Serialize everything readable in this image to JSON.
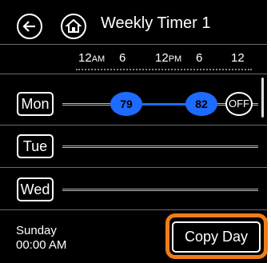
{
  "header": {
    "title": "Weekly Timer 1",
    "back_icon": "back-arrow-icon",
    "home_icon": "home-icon"
  },
  "timeline": {
    "ticks": [
      {
        "num": "12",
        "suffix": "AM"
      },
      {
        "num": "6",
        "suffix": ""
      },
      {
        "num": "12",
        "suffix": "PM"
      },
      {
        "num": "6",
        "suffix": ""
      },
      {
        "num": "12",
        "suffix": ""
      }
    ]
  },
  "days": [
    {
      "label": "Mon",
      "events": [
        {
          "type": "temp",
          "label": "79"
        },
        {
          "type": "temp",
          "label": "82"
        },
        {
          "type": "off",
          "label": "OFF"
        }
      ]
    },
    {
      "label": "Tue",
      "events": []
    },
    {
      "label": "Wed",
      "events": []
    }
  ],
  "footer": {
    "day": "Sunday",
    "time": "00:00 AM",
    "copy_label": "Copy Day"
  },
  "colors": {
    "accent": "#1e6bff",
    "highlight": "#ef7d1a",
    "background": "#000000"
  }
}
